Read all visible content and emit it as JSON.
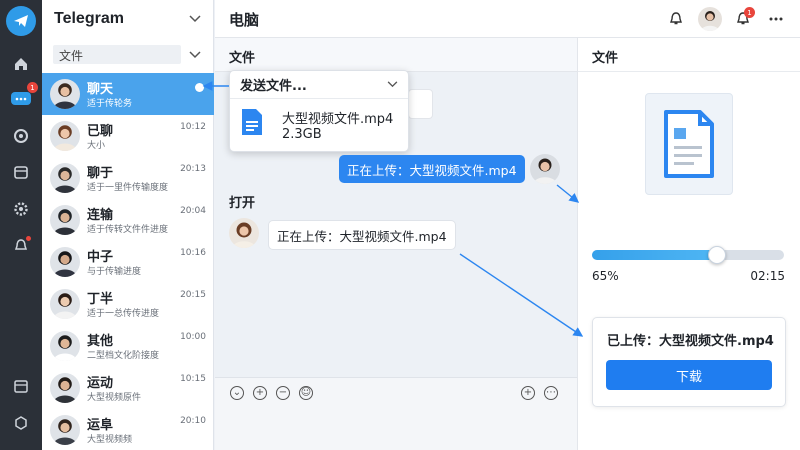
{
  "app": {
    "name": "Telegram"
  },
  "rail": {
    "chat_badge": "1"
  },
  "chat_list": {
    "filter_value": "文件",
    "chats": [
      {
        "name": "聊天",
        "preview": "适于传轮务",
        "time": ""
      },
      {
        "name": "已聊",
        "preview": "大小",
        "time": "10:12"
      },
      {
        "name": "聊于",
        "preview": "适于一里件传输度度",
        "time": "20:13"
      },
      {
        "name": "连输",
        "preview": "适于传转文件件进度",
        "time": "20:04"
      },
      {
        "name": "中子",
        "preview": "与于传输进度",
        "time": "10:16"
      },
      {
        "name": "丁半",
        "preview": "适于一总传传进度",
        "time": "20:15"
      },
      {
        "name": "其他",
        "preview": "二型档文化阶接度",
        "time": "10:00"
      },
      {
        "name": "运动",
        "preview": "大型视频原件",
        "time": "10:15"
      },
      {
        "name": "运阜",
        "preview": "大型视频频",
        "time": "20:10"
      }
    ]
  },
  "header": {
    "title": "电脑",
    "bell_badge": "1"
  },
  "conversation": {
    "section_title": "文件",
    "popup": {
      "title": "发送文件...",
      "file_name": "大型视频文件.mp4",
      "file_size": "2.3GB"
    },
    "out_message": "正在上传：大型视频文件.mp4",
    "open_label": "打开",
    "in_message": "正在上传：大型视频文件.mp4"
  },
  "file_panel": {
    "title": "文件",
    "progress_fraction": 0.65,
    "progress_text": "65%",
    "time_remaining": "02:15",
    "uploaded_text": "已上传：大型视频文件.mp4",
    "download_label": "下载"
  },
  "colors": {
    "accent": "#2c86f0",
    "rail": "#2b3038",
    "selected": "#4aa3ec"
  }
}
